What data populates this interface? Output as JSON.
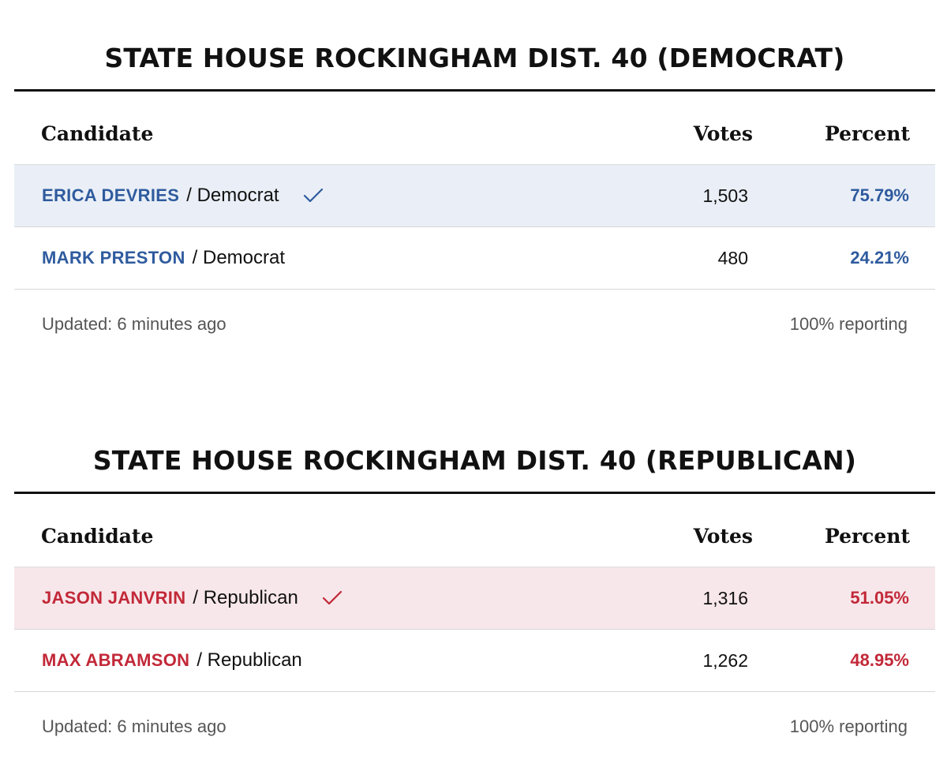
{
  "races": [
    {
      "title": "STATE HOUSE ROCKINGHAM DIST. 40 (DEMOCRAT)",
      "headers": {
        "candidate": "Candidate",
        "votes": "Votes",
        "percent": "Percent"
      },
      "candidates": [
        {
          "name": "ERICA DEVRIES",
          "party": "/ Democrat",
          "votes": "1,503",
          "percent": "75.79%",
          "winner": true
        },
        {
          "name": "MARK PRESTON",
          "party": "/ Democrat",
          "votes": "480",
          "percent": "24.21%",
          "winner": false
        }
      ],
      "updated": "Updated: 6 minutes ago",
      "reporting": "100% reporting",
      "accent_color": "#2f5b9e",
      "winner_row_color": "#eaeff7"
    },
    {
      "title": "STATE HOUSE ROCKINGHAM DIST. 40 (REPUBLICAN)",
      "headers": {
        "candidate": "Candidate",
        "votes": "Votes",
        "percent": "Percent"
      },
      "candidates": [
        {
          "name": "JASON JANVRIN",
          "party": "/ Republican",
          "votes": "1,316",
          "percent": "51.05%",
          "winner": true
        },
        {
          "name": "MAX ABRAMSON",
          "party": "/ Republican",
          "votes": "1,262",
          "percent": "48.95%",
          "winner": false
        }
      ],
      "updated": "Updated: 6 minutes ago",
      "reporting": "100% reporting",
      "accent_color": "#c22838",
      "winner_row_color": "#f7e7ea"
    }
  ],
  "icons": {
    "winner": "checkmark-icon"
  }
}
